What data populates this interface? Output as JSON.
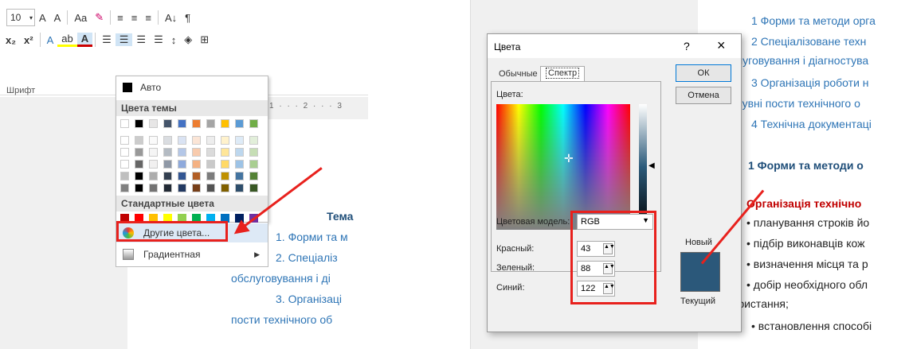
{
  "left_panel": {
    "font_size": "10",
    "ribbon_row1": [
      "A",
      "A",
      "Aa",
      "≡",
      "≡",
      "≡",
      "A↓",
      "¶"
    ],
    "ribbon_row2": [
      "x₂",
      "x²",
      "A",
      "ab",
      "A"
    ],
    "group_label": "Шрифт",
    "ruler": "1 · · · 2 · · · 3",
    "doc_heading": "Тема",
    "doc_lines": [
      "1. Форми та м",
      "2.   Спеціаліз",
      "обслуговування і ді",
      "3. Організаці",
      "пости технічного об"
    ],
    "dropdown": {
      "auto_label": "Авто",
      "theme_colors_label": "Цвета темы",
      "standard_colors_label": "Стандартные цвета",
      "more_colors_label": "Другие цвета...",
      "gradient_label": "Градиентная",
      "theme_colors": [
        "#ffffff",
        "#000000",
        "#e7e6e6",
        "#44546a",
        "#4472c4",
        "#ed7d31",
        "#a5a5a5",
        "#ffc000",
        "#5b9bd5",
        "#70ad47"
      ],
      "standard_colors": [
        "#c00000",
        "#ff0000",
        "#ffc000",
        "#ffff00",
        "#92d050",
        "#00b050",
        "#00b0f0",
        "#0070c0",
        "#002060",
        "#7030a0"
      ]
    }
  },
  "right_panel": {
    "doc_lines": [
      "1 Форми та методи орга",
      "2  Спеціалізоване  техн",
      "слуговування і діагностува",
      "3 Організація  роботи  н",
      "ресувні пости технічного о",
      "4 Технічна документаці"
    ],
    "heading": "1  Форми та методи о",
    "sub_heading": "Організація технічно",
    "bullets": [
      "планування строків йо",
      "підбір виконавців кож",
      "визначення місця та р",
      "добір необхідного обл"
    ],
    "continuation": "використання;",
    "last_bullet": "встановлення способі",
    "dialog": {
      "title": "Цвета",
      "help": "?",
      "close": "×",
      "tab_standard": "Обычные",
      "tab_custom": "Спектр",
      "ok_label": "ОК",
      "cancel_label": "Отмена",
      "colors_label": "Цвета:",
      "color_model_label": "Цветовая модель:",
      "color_model_value": "RGB",
      "red_label": "Красный:",
      "green_label": "Зеленый:",
      "blue_label": "Синий:",
      "red_value": "43",
      "green_value": "88",
      "blue_value": "122",
      "new_label": "Новый",
      "current_label": "Текущий",
      "preview_color": "#2b587a"
    }
  }
}
